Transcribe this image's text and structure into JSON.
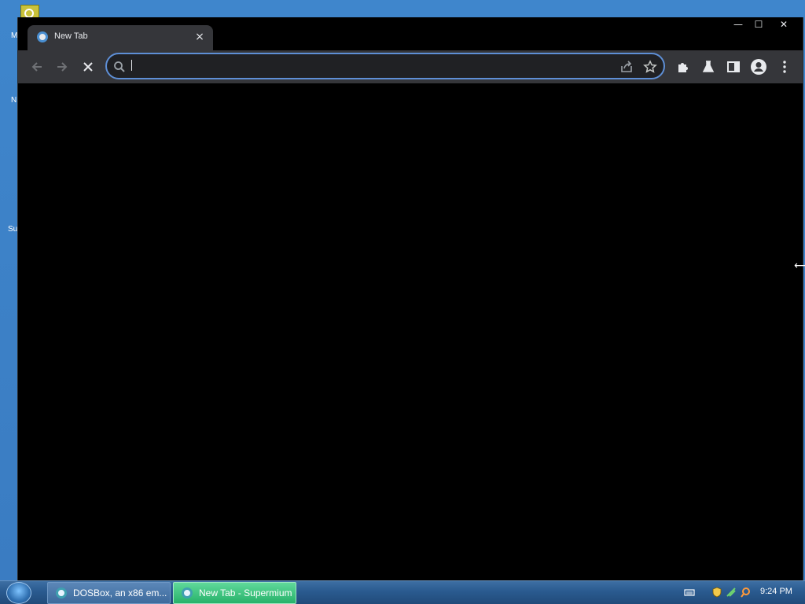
{
  "desktop": {
    "glyph_1": "M",
    "glyph_2": "N",
    "glyph_3": "Su"
  },
  "browser": {
    "tab": {
      "title": "New Tab",
      "close_symbol": "×"
    },
    "window_controls": {
      "minimize": "—",
      "maximize": "☐",
      "close": "✕"
    },
    "omnibox": {
      "value": "",
      "placeholder": ""
    },
    "accent_color": "#5e8fd6"
  },
  "taskbar": {
    "items": [
      {
        "label": "DOSBox, an x86 em...",
        "active": false
      },
      {
        "label": "New Tab - Supermium",
        "active": true
      }
    ],
    "clock": "9:24 PM"
  }
}
